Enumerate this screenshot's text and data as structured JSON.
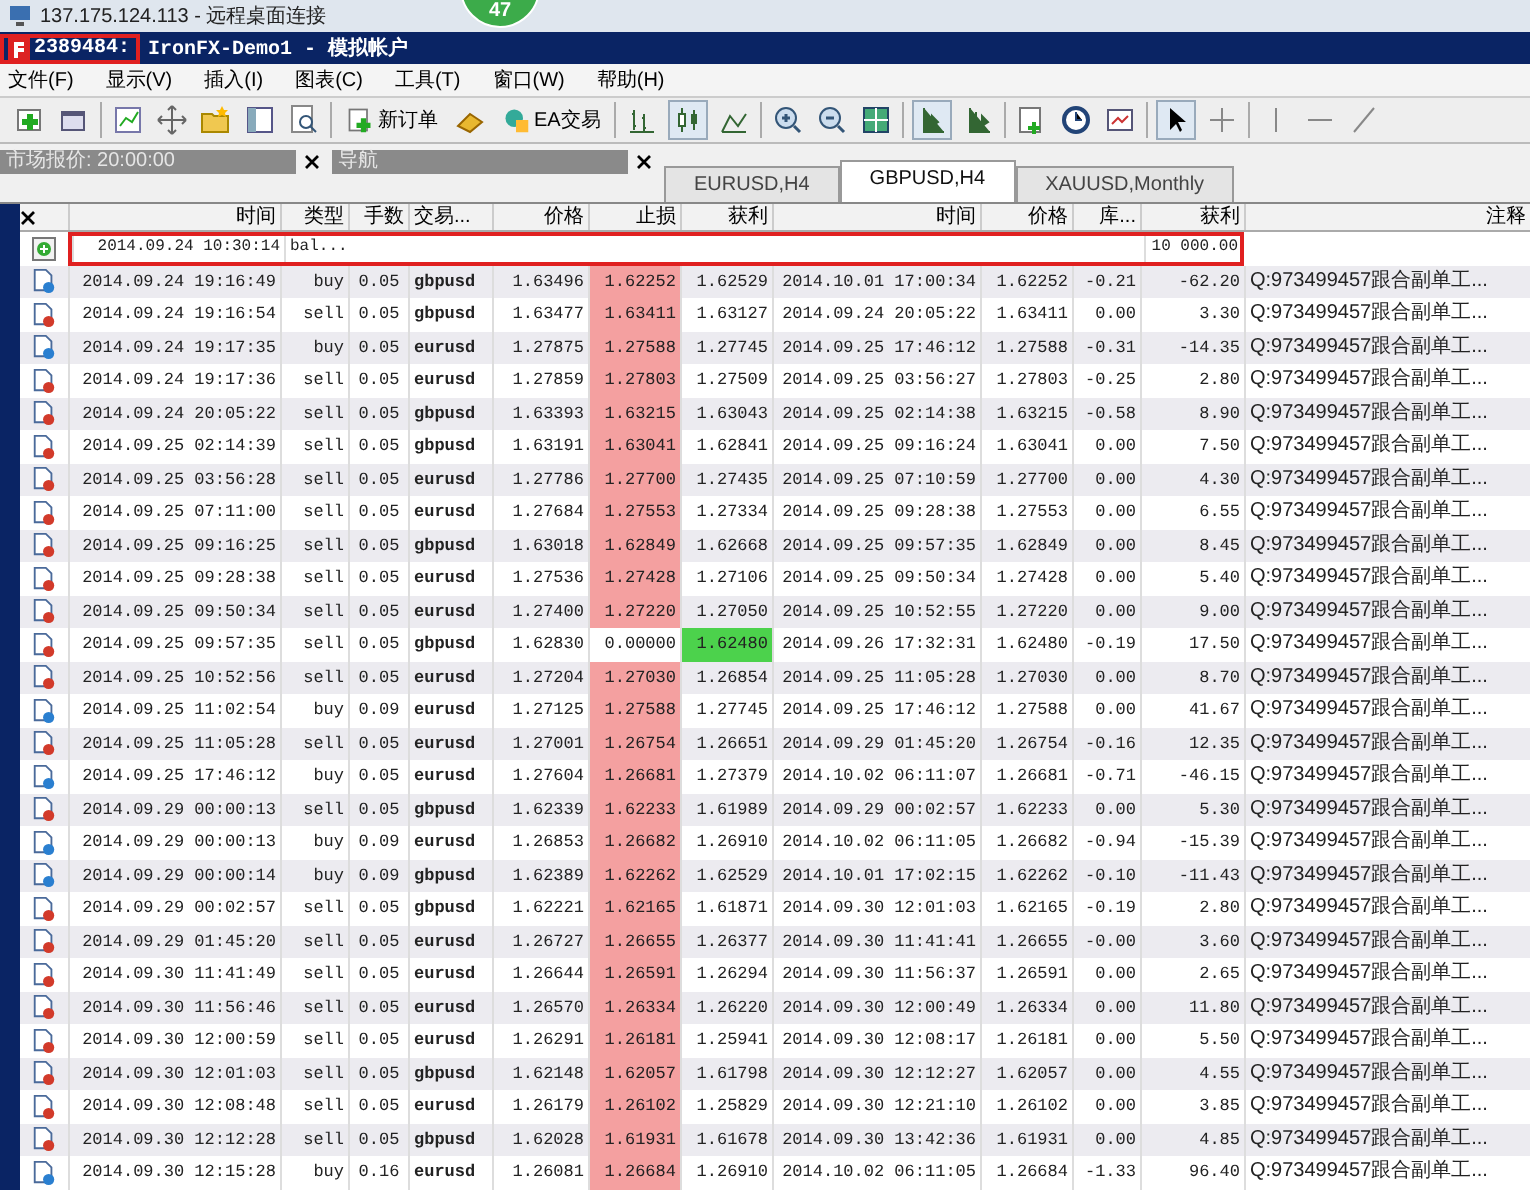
{
  "window": {
    "title": "137.175.124.113 - 远程桌面连接",
    "badge": "47"
  },
  "account": {
    "number": "2389484:",
    "server": "IronFX-Demo1 - 模拟帐户",
    "highlighted": true
  },
  "menu": [
    "文件(F)",
    "显示(V)",
    "插入(I)",
    "图表(C)",
    "工具(T)",
    "窗口(W)",
    "帮助(H)"
  ],
  "toolbar": {
    "buttons": [
      {
        "label": "新订单"
      },
      {
        "label": "EA交易"
      }
    ]
  },
  "panels": [
    {
      "title": "市场报价: 20:00:00"
    },
    {
      "title": "导航"
    }
  ],
  "chart_tabs": [
    {
      "label": "EURUSD,H4",
      "selected": false
    },
    {
      "label": "GBPUSD,H4",
      "selected": true
    },
    {
      "label": "XAUUSD,Monthly",
      "selected": false
    }
  ],
  "table": {
    "columns": [
      "时间",
      "类型",
      "手数",
      "交易...",
      "价格",
      "止损",
      "获利",
      "时间",
      "价格",
      "库...",
      "获利",
      "注释"
    ],
    "rows": [
      {
        "kind": "balance",
        "highlighted": true,
        "time": "2014.09.24 10:30:14",
        "type": "bal...",
        "profit": "10 000.00"
      },
      {
        "kind": "buy",
        "sl_hit": true,
        "tp_hit": false,
        "cells": [
          "2014.09.24 19:16:49",
          "buy",
          "0.05",
          "gbpusd",
          "1.63496",
          "1.62252",
          "1.62529",
          "2014.10.01 17:00:34",
          "1.62252",
          "-0.21",
          "-62.20"
        ],
        "comment": "Q:973499457跟合副单工..."
      },
      {
        "kind": "sell",
        "sl_hit": true,
        "tp_hit": false,
        "cells": [
          "2014.09.24 19:16:54",
          "sell",
          "0.05",
          "gbpusd",
          "1.63477",
          "1.63411",
          "1.63127",
          "2014.09.24 20:05:22",
          "1.63411",
          "0.00",
          "3.30"
        ],
        "comment": "Q:973499457跟合副单工..."
      },
      {
        "kind": "buy",
        "sl_hit": true,
        "tp_hit": false,
        "cells": [
          "2014.09.24 19:17:35",
          "buy",
          "0.05",
          "eurusd",
          "1.27875",
          "1.27588",
          "1.27745",
          "2014.09.25 17:46:12",
          "1.27588",
          "-0.31",
          "-14.35"
        ],
        "comment": "Q:973499457跟合副单工..."
      },
      {
        "kind": "sell",
        "sl_hit": true,
        "tp_hit": false,
        "cells": [
          "2014.09.24 19:17:36",
          "sell",
          "0.05",
          "eurusd",
          "1.27859",
          "1.27803",
          "1.27509",
          "2014.09.25 03:56:27",
          "1.27803",
          "-0.25",
          "2.80"
        ],
        "comment": "Q:973499457跟合副单工..."
      },
      {
        "kind": "sell",
        "sl_hit": true,
        "tp_hit": false,
        "cells": [
          "2014.09.24 20:05:22",
          "sell",
          "0.05",
          "gbpusd",
          "1.63393",
          "1.63215",
          "1.63043",
          "2014.09.25 02:14:38",
          "1.63215",
          "-0.58",
          "8.90"
        ],
        "comment": "Q:973499457跟合副单工..."
      },
      {
        "kind": "sell",
        "sl_hit": true,
        "tp_hit": false,
        "cells": [
          "2014.09.25 02:14:39",
          "sell",
          "0.05",
          "gbpusd",
          "1.63191",
          "1.63041",
          "1.62841",
          "2014.09.25 09:16:24",
          "1.63041",
          "0.00",
          "7.50"
        ],
        "comment": "Q:973499457跟合副单工..."
      },
      {
        "kind": "sell",
        "sl_hit": true,
        "tp_hit": false,
        "cells": [
          "2014.09.25 03:56:28",
          "sell",
          "0.05",
          "eurusd",
          "1.27786",
          "1.27700",
          "1.27435",
          "2014.09.25 07:10:59",
          "1.27700",
          "0.00",
          "4.30"
        ],
        "comment": "Q:973499457跟合副单工..."
      },
      {
        "kind": "sell",
        "sl_hit": true,
        "tp_hit": false,
        "cells": [
          "2014.09.25 07:11:00",
          "sell",
          "0.05",
          "eurusd",
          "1.27684",
          "1.27553",
          "1.27334",
          "2014.09.25 09:28:38",
          "1.27553",
          "0.00",
          "6.55"
        ],
        "comment": "Q:973499457跟合副单工..."
      },
      {
        "kind": "sell",
        "sl_hit": true,
        "tp_hit": false,
        "cells": [
          "2014.09.25 09:16:25",
          "sell",
          "0.05",
          "gbpusd",
          "1.63018",
          "1.62849",
          "1.62668",
          "2014.09.25 09:57:35",
          "1.62849",
          "0.00",
          "8.45"
        ],
        "comment": "Q:973499457跟合副单工..."
      },
      {
        "kind": "sell",
        "sl_hit": true,
        "tp_hit": false,
        "cells": [
          "2014.09.25 09:28:38",
          "sell",
          "0.05",
          "eurusd",
          "1.27536",
          "1.27428",
          "1.27106",
          "2014.09.25 09:50:34",
          "1.27428",
          "0.00",
          "5.40"
        ],
        "comment": "Q:973499457跟合副单工..."
      },
      {
        "kind": "sell",
        "sl_hit": true,
        "tp_hit": false,
        "cells": [
          "2014.09.25 09:50:34",
          "sell",
          "0.05",
          "eurusd",
          "1.27400",
          "1.27220",
          "1.27050",
          "2014.09.25 10:52:55",
          "1.27220",
          "0.00",
          "9.00"
        ],
        "comment": "Q:973499457跟合副单工..."
      },
      {
        "kind": "sell",
        "sl_hit": false,
        "tp_hit": true,
        "cells": [
          "2014.09.25 09:57:35",
          "sell",
          "0.05",
          "gbpusd",
          "1.62830",
          "0.00000",
          "1.62480",
          "2014.09.26 17:32:31",
          "1.62480",
          "-0.19",
          "17.50"
        ],
        "comment": "Q:973499457跟合副单工..."
      },
      {
        "kind": "sell",
        "sl_hit": true,
        "tp_hit": false,
        "cells": [
          "2014.09.25 10:52:56",
          "sell",
          "0.05",
          "eurusd",
          "1.27204",
          "1.27030",
          "1.26854",
          "2014.09.25 11:05:28",
          "1.27030",
          "0.00",
          "8.70"
        ],
        "comment": "Q:973499457跟合副单工..."
      },
      {
        "kind": "buy",
        "sl_hit": true,
        "tp_hit": false,
        "cells": [
          "2014.09.25 11:02:54",
          "buy",
          "0.09",
          "eurusd",
          "1.27125",
          "1.27588",
          "1.27745",
          "2014.09.25 17:46:12",
          "1.27588",
          "0.00",
          "41.67"
        ],
        "comment": "Q:973499457跟合副单工..."
      },
      {
        "kind": "sell",
        "sl_hit": true,
        "tp_hit": false,
        "cells": [
          "2014.09.25 11:05:28",
          "sell",
          "0.05",
          "eurusd",
          "1.27001",
          "1.26754",
          "1.26651",
          "2014.09.29 01:45:20",
          "1.26754",
          "-0.16",
          "12.35"
        ],
        "comment": "Q:973499457跟合副单工..."
      },
      {
        "kind": "buy",
        "sl_hit": true,
        "tp_hit": false,
        "cells": [
          "2014.09.25 17:46:12",
          "buy",
          "0.05",
          "eurusd",
          "1.27604",
          "1.26681",
          "1.27379",
          "2014.10.02 06:11:07",
          "1.26681",
          "-0.71",
          "-46.15"
        ],
        "comment": "Q:973499457跟合副单工..."
      },
      {
        "kind": "sell",
        "sl_hit": true,
        "tp_hit": false,
        "cells": [
          "2014.09.29 00:00:13",
          "sell",
          "0.05",
          "gbpusd",
          "1.62339",
          "1.62233",
          "1.61989",
          "2014.09.29 00:02:57",
          "1.62233",
          "0.00",
          "5.30"
        ],
        "comment": "Q:973499457跟合副单工..."
      },
      {
        "kind": "buy",
        "sl_hit": true,
        "tp_hit": false,
        "cells": [
          "2014.09.29 00:00:13",
          "buy",
          "0.09",
          "eurusd",
          "1.26853",
          "1.26682",
          "1.26910",
          "2014.10.02 06:11:05",
          "1.26682",
          "-0.94",
          "-15.39"
        ],
        "comment": "Q:973499457跟合副单工..."
      },
      {
        "kind": "buy",
        "sl_hit": true,
        "tp_hit": false,
        "cells": [
          "2014.09.29 00:00:14",
          "buy",
          "0.09",
          "gbpusd",
          "1.62389",
          "1.62262",
          "1.62529",
          "2014.10.01 17:02:15",
          "1.62262",
          "-0.10",
          "-11.43"
        ],
        "comment": "Q:973499457跟合副单工..."
      },
      {
        "kind": "sell",
        "sl_hit": true,
        "tp_hit": false,
        "cells": [
          "2014.09.29 00:02:57",
          "sell",
          "0.05",
          "gbpusd",
          "1.62221",
          "1.62165",
          "1.61871",
          "2014.09.30 12:01:03",
          "1.62165",
          "-0.19",
          "2.80"
        ],
        "comment": "Q:973499457跟合副单工..."
      },
      {
        "kind": "sell",
        "sl_hit": true,
        "tp_hit": false,
        "cells": [
          "2014.09.29 01:45:20",
          "sell",
          "0.05",
          "eurusd",
          "1.26727",
          "1.26655",
          "1.26377",
          "2014.09.30 11:41:41",
          "1.26655",
          "-0.00",
          "3.60"
        ],
        "comment": "Q:973499457跟合副单工..."
      },
      {
        "kind": "sell",
        "sl_hit": true,
        "tp_hit": false,
        "cells": [
          "2014.09.30 11:41:49",
          "sell",
          "0.05",
          "eurusd",
          "1.26644",
          "1.26591",
          "1.26294",
          "2014.09.30 11:56:37",
          "1.26591",
          "0.00",
          "2.65"
        ],
        "comment": "Q:973499457跟合副单工..."
      },
      {
        "kind": "sell",
        "sl_hit": true,
        "tp_hit": false,
        "cells": [
          "2014.09.30 11:56:46",
          "sell",
          "0.05",
          "eurusd",
          "1.26570",
          "1.26334",
          "1.26220",
          "2014.09.30 12:00:49",
          "1.26334",
          "0.00",
          "11.80"
        ],
        "comment": "Q:973499457跟合副单工..."
      },
      {
        "kind": "sell",
        "sl_hit": true,
        "tp_hit": false,
        "cells": [
          "2014.09.30 12:00:59",
          "sell",
          "0.05",
          "eurusd",
          "1.26291",
          "1.26181",
          "1.25941",
          "2014.09.30 12:08:17",
          "1.26181",
          "0.00",
          "5.50"
        ],
        "comment": "Q:973499457跟合副单工..."
      },
      {
        "kind": "sell",
        "sl_hit": true,
        "tp_hit": false,
        "cells": [
          "2014.09.30 12:01:03",
          "sell",
          "0.05",
          "gbpusd",
          "1.62148",
          "1.62057",
          "1.61798",
          "2014.09.30 12:12:27",
          "1.62057",
          "0.00",
          "4.55"
        ],
        "comment": "Q:973499457跟合副单工..."
      },
      {
        "kind": "sell",
        "sl_hit": true,
        "tp_hit": false,
        "cells": [
          "2014.09.30 12:08:48",
          "sell",
          "0.05",
          "eurusd",
          "1.26179",
          "1.26102",
          "1.25829",
          "2014.09.30 12:21:10",
          "1.26102",
          "0.00",
          "3.85"
        ],
        "comment": "Q:973499457跟合副单工..."
      },
      {
        "kind": "sell",
        "sl_hit": true,
        "tp_hit": false,
        "cells": [
          "2014.09.30 12:12:28",
          "sell",
          "0.05",
          "gbpusd",
          "1.62028",
          "1.61931",
          "1.61678",
          "2014.09.30 13:42:36",
          "1.61931",
          "0.00",
          "4.85"
        ],
        "comment": "Q:973499457跟合副单工..."
      },
      {
        "kind": "buy",
        "sl_hit": true,
        "tp_hit": false,
        "cells": [
          "2014.09.30 12:15:28",
          "buy",
          "0.16",
          "eurusd",
          "1.26081",
          "1.26684",
          "1.26910",
          "2014.10.02 06:11:05",
          "1.26684",
          "-1.33",
          "96.40"
        ],
        "comment": "Q:973499457跟合副单工..."
      }
    ]
  }
}
